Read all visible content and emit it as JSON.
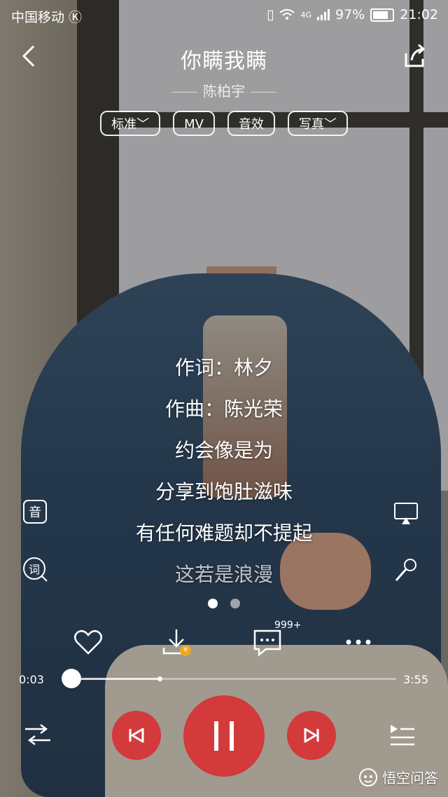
{
  "status": {
    "carrier": "中国移动",
    "network": "4G",
    "battery": "97%",
    "time": "21:02"
  },
  "song": {
    "title": "你瞒我瞒",
    "artist": "陈柏宇"
  },
  "chips": [
    "标准",
    "MV",
    "音效",
    "写真"
  ],
  "lyrics": [
    "作词：林夕",
    "作曲：陈光荣",
    "约会像是为",
    "分享到饱肚滋味",
    "有任何难题却不提起",
    "这若是浪漫"
  ],
  "side": {
    "left_top": "音",
    "left_bottom": "词"
  },
  "actions": {
    "comment_badge": "999+"
  },
  "player": {
    "current": "0:03",
    "total": "3:55",
    "progress": 0.013,
    "buffered": 0.28
  },
  "watermark": {
    "text": "悟空问答"
  }
}
